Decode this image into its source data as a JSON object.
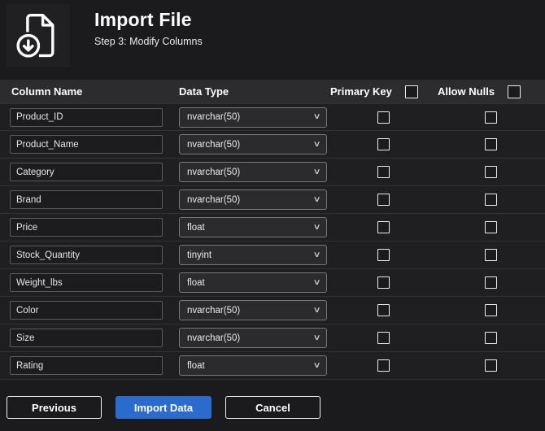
{
  "header": {
    "title": "Import File",
    "subtitle": "Step 3: Modify Columns"
  },
  "table": {
    "headers": {
      "column_name": "Column Name",
      "data_type": "Data Type",
      "primary_key": "Primary Key",
      "allow_nulls": "Allow Nulls"
    },
    "select_all": {
      "primary_key_checked": false,
      "allow_nulls_checked": false
    },
    "rows": [
      {
        "name": "Product_ID",
        "type": "nvarchar(50)",
        "primary_key": false,
        "allow_nulls": false
      },
      {
        "name": "Product_Name",
        "type": "nvarchar(50)",
        "primary_key": false,
        "allow_nulls": false
      },
      {
        "name": "Category",
        "type": "nvarchar(50)",
        "primary_key": false,
        "allow_nulls": false
      },
      {
        "name": "Brand",
        "type": "nvarchar(50)",
        "primary_key": false,
        "allow_nulls": false
      },
      {
        "name": "Price",
        "type": "float",
        "primary_key": false,
        "allow_nulls": false
      },
      {
        "name": "Stock_Quantity",
        "type": "tinyint",
        "primary_key": false,
        "allow_nulls": false
      },
      {
        "name": "Weight_lbs",
        "type": "float",
        "primary_key": false,
        "allow_nulls": false
      },
      {
        "name": "Color",
        "type": "nvarchar(50)",
        "primary_key": false,
        "allow_nulls": false
      },
      {
        "name": "Size",
        "type": "nvarchar(50)",
        "primary_key": false,
        "allow_nulls": false
      },
      {
        "name": "Rating",
        "type": "float",
        "primary_key": false,
        "allow_nulls": false
      }
    ]
  },
  "footer": {
    "previous_label": "Previous",
    "import_label": "Import Data",
    "cancel_label": "Cancel"
  },
  "colors": {
    "accent": "#2a6cce",
    "background": "#1b1b1d",
    "header_row": "#2c2c2f"
  }
}
